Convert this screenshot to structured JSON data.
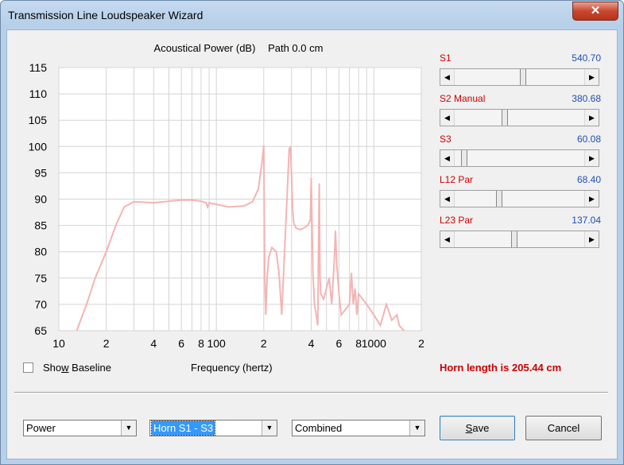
{
  "window": {
    "title": "Transmission Line Loudspeaker Wizard",
    "close_symbol": "✕"
  },
  "chart_header": {
    "title": "Acoustical Power (dB)",
    "path": "Path 0.0 cm"
  },
  "chart_data": {
    "type": "line",
    "title": "Acoustical Power (dB)   Path 0.0 cm",
    "xlabel": "Frequency (hertz)",
    "ylabel": "",
    "x_scale": "log",
    "xlim": [
      10,
      2000
    ],
    "ylim": [
      65,
      115
    ],
    "y_ticks": [
      115,
      110,
      105,
      100,
      95,
      90,
      85,
      80,
      75,
      70,
      65
    ],
    "x_tick_labels": [
      "10",
      "2",
      "4",
      "6",
      "8",
      "100",
      "2",
      "4",
      "6",
      "8",
      "1000",
      "2"
    ],
    "x_tick_values": [
      10,
      20,
      40,
      60,
      80,
      100,
      200,
      400,
      600,
      800,
      1000,
      2000
    ],
    "grid": true,
    "series_color": "#f4b4b4",
    "series": [
      {
        "x": [
          13,
          15,
          17,
          20,
          23,
          26,
          30,
          40,
          50,
          60,
          70,
          80,
          86,
          88,
          90,
          100,
          120,
          150,
          170,
          185,
          195,
          200,
          203,
          206,
          210,
          215,
          225,
          240,
          250,
          260,
          270,
          290,
          295,
          300,
          305,
          310,
          320,
          340,
          360,
          380,
          395,
          400,
          405,
          410,
          420,
          440,
          450,
          455,
          460,
          480,
          520,
          540,
          560,
          570,
          580,
          600,
          620,
          700,
          720,
          740,
          760,
          780,
          800,
          900,
          1000,
          1100,
          1200,
          1300,
          1400,
          1450,
          1500,
          1550
        ],
        "y": [
          65,
          70,
          75,
          80,
          85,
          88.5,
          89.5,
          89.3,
          89.6,
          89.8,
          89.8,
          89.6,
          89.3,
          88.5,
          89.3,
          89,
          88.5,
          88.7,
          89.5,
          92,
          97,
          100.2,
          75,
          68,
          75,
          79,
          80.8,
          80,
          76,
          68,
          79,
          99.5,
          100,
          95,
          88,
          85.5,
          84.5,
          84.2,
          84.5,
          85,
          86,
          94,
          85,
          76,
          70,
          66,
          93,
          75,
          72,
          71,
          75,
          70,
          78,
          84,
          78,
          72,
          68,
          70,
          76,
          70,
          73,
          68,
          72,
          70,
          68,
          66,
          70,
          67,
          68,
          66,
          65.5,
          65
        ]
      }
    ]
  },
  "sliders": [
    {
      "label": "S1",
      "value": "540.70",
      "position": 0.53
    },
    {
      "label": "S2  Manual",
      "value": "380.68",
      "position": 0.38
    },
    {
      "label": "S3",
      "value": "60.08",
      "position": 0.06
    },
    {
      "label": "L12  Par",
      "value": "68.40",
      "position": 0.34
    },
    {
      "label": "L23  Par",
      "value": "137.04",
      "position": 0.46
    }
  ],
  "arrows": {
    "left": "◀",
    "right": "▶",
    "down": "▼"
  },
  "show_baseline": {
    "pre": "Sho",
    "underlined": "w",
    "post": " Baseline",
    "checked": false
  },
  "x_axis_label": "Frequency (hertz)",
  "horn_length": "Horn length is 205.44 cm",
  "combos": [
    {
      "value": "Power"
    },
    {
      "value": "Horn S1 - S3"
    },
    {
      "value": "Combined"
    }
  ],
  "buttons": {
    "save_pre": "",
    "save_underlined": "S",
    "save_post": "ave",
    "cancel": "Cancel"
  }
}
